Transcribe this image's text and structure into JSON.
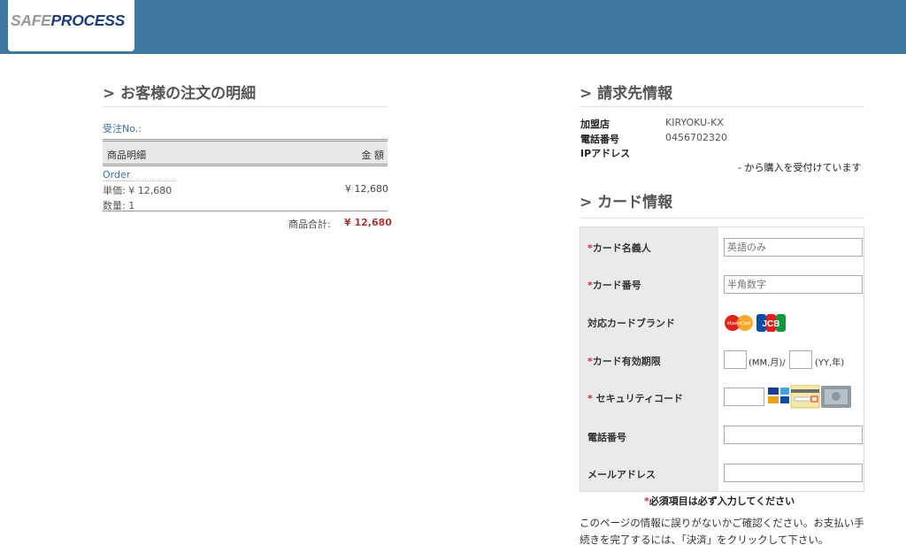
{
  "header": {
    "logo_safe": "SAFE",
    "logo_process": "PROCESS"
  },
  "order": {
    "title": "> お客様の注文の明細",
    "order_no_label": "受注No.:",
    "col_item": "商品明細",
    "col_amount": "金 額",
    "item_name": "Order",
    "unit_price": "単価: ¥ 12,680",
    "quantity": "数量: 1",
    "item_amount": "¥ 12,680",
    "subtotal_label": "商品合計:",
    "subtotal_value": "¥ 12,680"
  },
  "billing": {
    "title": "> 請求先情報",
    "merchant_label": "加盟店",
    "merchant_value": "KIRYOKU-KX",
    "phone_label": "電話番号",
    "phone_value": "0456702320",
    "ip_label": "IPアドレス",
    "accept_text": "- から購入を受付けています"
  },
  "card": {
    "title": "> カード情報",
    "holder_label": "カード名義人",
    "holder_placeholder": "英語のみ",
    "number_label": "カード番号",
    "number_placeholder": "半角数字",
    "brands_label": "対応カードブランド",
    "brand_mc": "MasterCard",
    "brand_jcb": "JCB",
    "expiry_label": "カード有効期限",
    "expiry_month_unit": "(MM,月)/",
    "expiry_year_unit": "(YY,年)",
    "cvv_label": "セキュリティコード",
    "tel_label": "電話番号",
    "email_label": "メールアドレス",
    "required_mark": "*",
    "required_notice": "必須項目は必ず入力してください",
    "confirm_text": "このページの情報に誤りがないかご確認ください。お支払い手続きを完了するには、「決済」をクリックして下さい。"
  },
  "colors": {
    "header": "#41789f",
    "accent": "#a23a3a",
    "link": "#3a6fa3"
  }
}
